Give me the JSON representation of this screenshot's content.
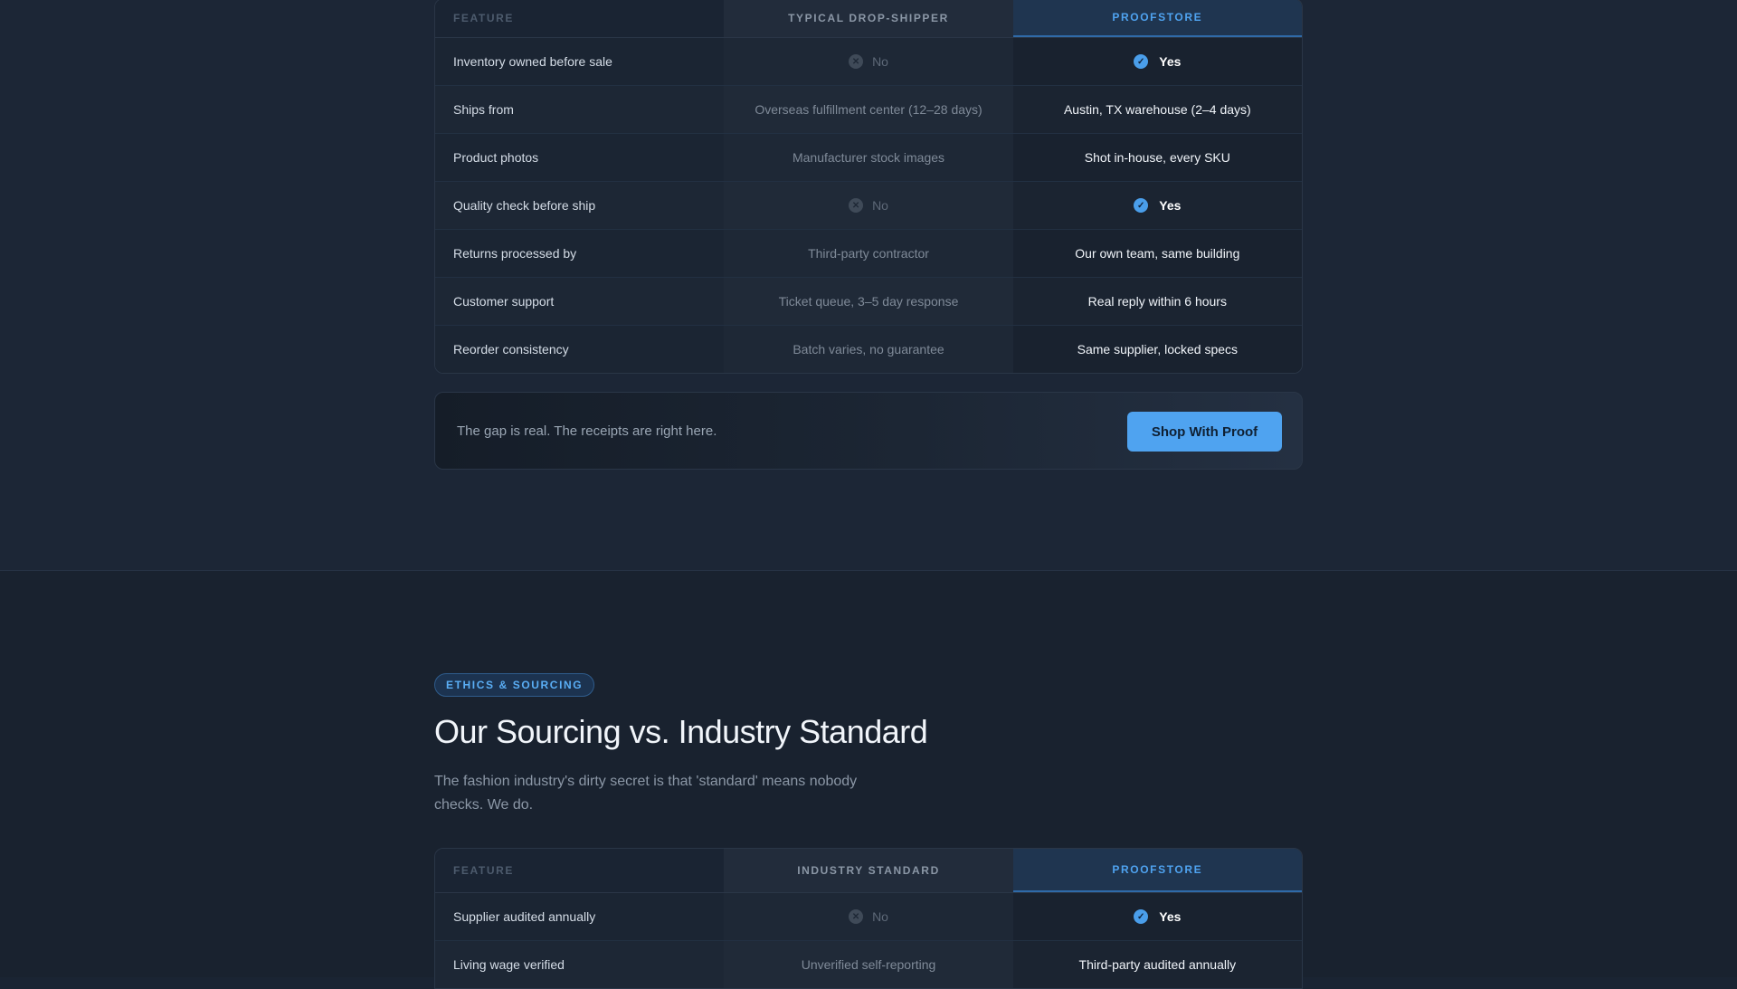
{
  "comparison1": {
    "headers": {
      "feature": "FEATURE",
      "competitor": "TYPICAL DROP-SHIPPER",
      "brand": "PROOFSTORE"
    },
    "rows": [
      {
        "feature": "Inventory owned before sale",
        "competitor": "No",
        "brand": "Yes"
      },
      {
        "feature": "Ships from",
        "competitor": "Overseas fulfillment center (12–28 days)",
        "brand": "Austin, TX warehouse (2–4 days)"
      },
      {
        "feature": "Product photos",
        "competitor": "Manufacturer stock images",
        "brand": "Shot in-house, every SKU"
      },
      {
        "feature": "Quality check before ship",
        "competitor": "No",
        "brand": "Yes"
      },
      {
        "feature": "Returns processed by",
        "competitor": "Third-party contractor",
        "brand": "Our own team, same building"
      },
      {
        "feature": "Customer support",
        "competitor": "Ticket queue, 3–5 day response",
        "brand": "Real reply within 6 hours"
      },
      {
        "feature": "Reorder consistency",
        "competitor": "Batch varies, no guarantee",
        "brand": "Same supplier, locked specs"
      }
    ]
  },
  "cta": {
    "text": "The gap is real. The receipts are right here.",
    "button": "Shop With Proof"
  },
  "ethics": {
    "pill": "ETHICS & SOURCING",
    "title": "Our Sourcing vs. Industry Standard",
    "subtitle": "The fashion industry's dirty secret is that 'standard' means nobody checks. We do."
  },
  "comparison2": {
    "headers": {
      "feature": "FEATURE",
      "competitor": "INDUSTRY STANDARD",
      "brand": "PROOFSTORE"
    },
    "rows": [
      {
        "feature": "Supplier audited annually",
        "competitor": "No",
        "brand": "Yes"
      },
      {
        "feature": "Living wage verified",
        "competitor": "Unverified self-reporting",
        "brand": "Third-party audited annually"
      }
    ]
  },
  "icons": {
    "no": "x-circle-icon",
    "yes": "check-circle-icon"
  },
  "colors": {
    "accent": "#4fa3f0",
    "background": "#1a2433"
  }
}
